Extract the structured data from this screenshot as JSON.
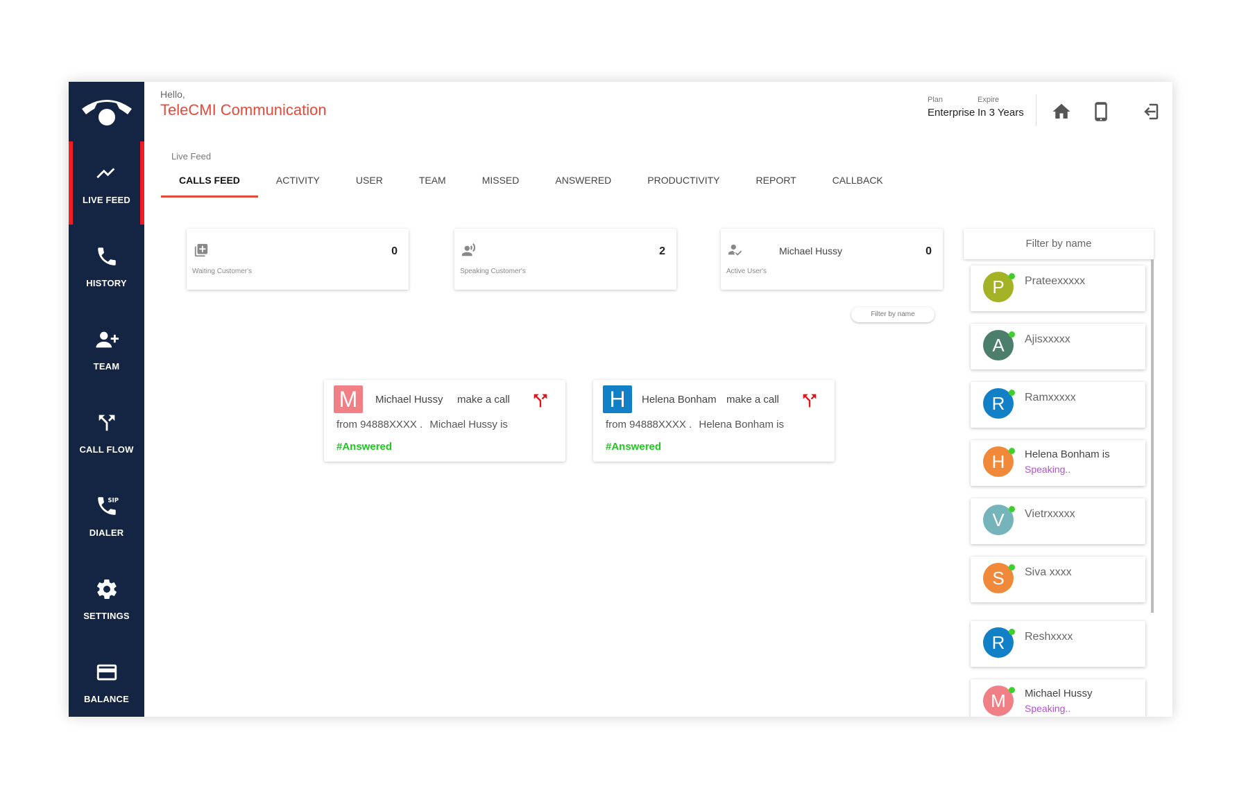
{
  "sidebar": {
    "items": [
      {
        "label": "LIVE FEED",
        "icon": "trending-up-icon"
      },
      {
        "label": "HISTORY",
        "icon": "phone-icon"
      },
      {
        "label": "TEAM",
        "icon": "team-add-icon"
      },
      {
        "label": "CALL FLOW",
        "icon": "call-split-icon"
      },
      {
        "label": "DIALER",
        "icon": "sip-phone-icon"
      },
      {
        "label": "SETTINGS",
        "icon": "gear-icon"
      },
      {
        "label": "BALANCE",
        "icon": "credit-card-icon"
      }
    ]
  },
  "header": {
    "greeting": "Hello,",
    "company": "TeleCMI Communication",
    "plan_label": "Plan",
    "plan_value": "Enterprise",
    "expire_label": "Expire",
    "expire_value": "In 3 Years"
  },
  "live_feed_label": "Live Feed",
  "tabs": [
    "CALLS FEED",
    "ACTIVITY",
    "USER",
    "TEAM",
    "MISSED",
    "ANSWERED",
    "PRODUCTIVITY",
    "REPORT",
    "CALLBACK"
  ],
  "stats": {
    "waiting": {
      "count": "0",
      "label": "Waiting Customer's"
    },
    "speaking": {
      "count": "2",
      "label": "Speaking Customer's"
    },
    "active": {
      "count": "0",
      "label": "Active User's",
      "name": "Michael Hussy"
    }
  },
  "small_filter": "Filter by name",
  "calls": [
    {
      "initial": "M",
      "name": "Michael Hussy",
      "action": "make a call",
      "from": "from 94888XXXX .",
      "is_text": "Michael Hussy is",
      "status": "#Answered",
      "color": "#f07f86"
    },
    {
      "initial": "H",
      "name": "Helena Bonham",
      "action": "make a call",
      "from": "from 94888XXXX .",
      "is_text": "Helena Bonham is",
      "status": "#Answered",
      "color": "#1280c7"
    }
  ],
  "right_panel": {
    "filter": "Filter by name",
    "users": [
      {
        "initial": "P",
        "name": "Prateexxxxx",
        "status": "",
        "color": "#a3b325"
      },
      {
        "initial": "A",
        "name": "Ajisxxxxx",
        "status": "",
        "color": "#4b7f6b"
      },
      {
        "initial": "R",
        "name": "Ramxxxxx",
        "status": "",
        "color": "#1280c7"
      },
      {
        "initial": "H",
        "name": "Helena Bonham is",
        "status": "Speaking..",
        "color": "#f08a3a"
      },
      {
        "initial": "V",
        "name": "Vietrxxxxx",
        "status": "",
        "color": "#76b4bc"
      },
      {
        "initial": "S",
        "name": "Siva xxxx",
        "status": "",
        "color": "#f08a3a"
      },
      {
        "initial": "R",
        "name": "Reshxxxx",
        "status": "",
        "color": "#1280c7"
      },
      {
        "initial": "M",
        "name": "Michael Hussy",
        "status": "Speaking..",
        "color": "#f07f86"
      }
    ]
  }
}
